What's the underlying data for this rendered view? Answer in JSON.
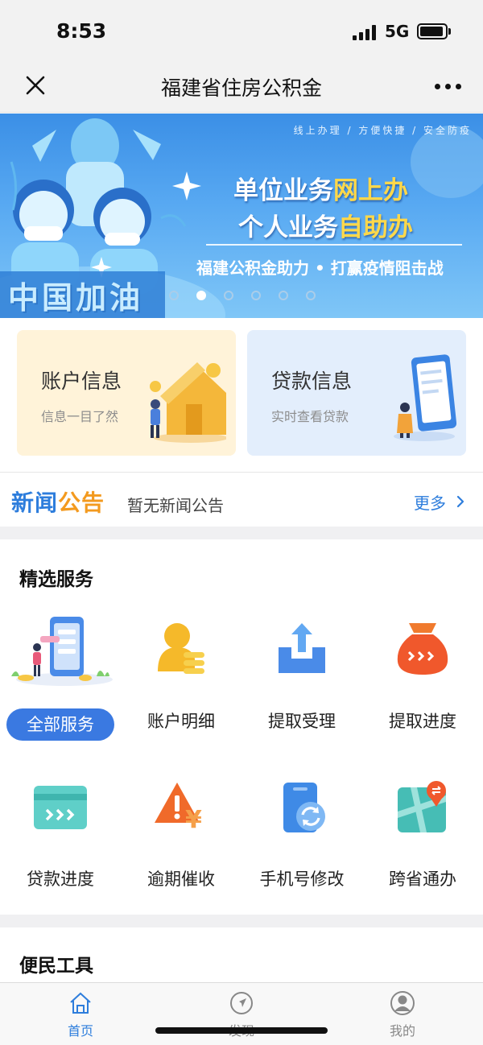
{
  "status_bar": {
    "time": "8:53",
    "network": "5G"
  },
  "nav": {
    "title": "福建省住房公积金",
    "close_icon": "close-icon",
    "more_icon": "more-icon"
  },
  "banner": {
    "tagline": "线上办理  /  方便快捷  /  安全防疫",
    "line1_prefix": "单位业务",
    "line1_highlight": "网上办",
    "line2_prefix": "个人业务",
    "line2_highlight": "自助办",
    "slogan": "福建公积金助力 • 打赢疫情阻击战",
    "cheer": "中国加油",
    "slide_count": 6,
    "active_slide": 2
  },
  "cards": {
    "account": {
      "title": "账户信息",
      "subtitle": "信息一目了然"
    },
    "loan": {
      "title": "贷款信息",
      "subtitle": "实时查看贷款"
    }
  },
  "news": {
    "logo_part1": "新闻",
    "logo_part2": "公告",
    "text": "暂无新闻公告",
    "more": "更多"
  },
  "services": {
    "title": "精选服务",
    "all_button": "全部服务",
    "items": [
      {
        "label": "账户明细",
        "icon": "account-detail-icon"
      },
      {
        "label": "提取受理",
        "icon": "upload-icon"
      },
      {
        "label": "提取进度",
        "icon": "progress-bag-icon"
      },
      {
        "label": "贷款进度",
        "icon": "card-progress-icon"
      },
      {
        "label": "逾期催收",
        "icon": "warning-yen-icon"
      },
      {
        "label": "手机号修改",
        "icon": "phone-refresh-icon"
      },
      {
        "label": "跨省通办",
        "icon": "map-icon"
      }
    ]
  },
  "tools": {
    "title": "便民工具"
  },
  "tab_bar": {
    "tabs": [
      {
        "label": "首页",
        "icon": "home-icon",
        "active": true
      },
      {
        "label": "发现",
        "icon": "compass-icon",
        "active": false
      },
      {
        "label": "我的",
        "icon": "user-icon",
        "active": false
      }
    ]
  },
  "colors": {
    "primary": "#2d7ddc",
    "button": "#3a79e1",
    "highlight": "#ffd84a",
    "news_orange": "#f39a1f"
  }
}
